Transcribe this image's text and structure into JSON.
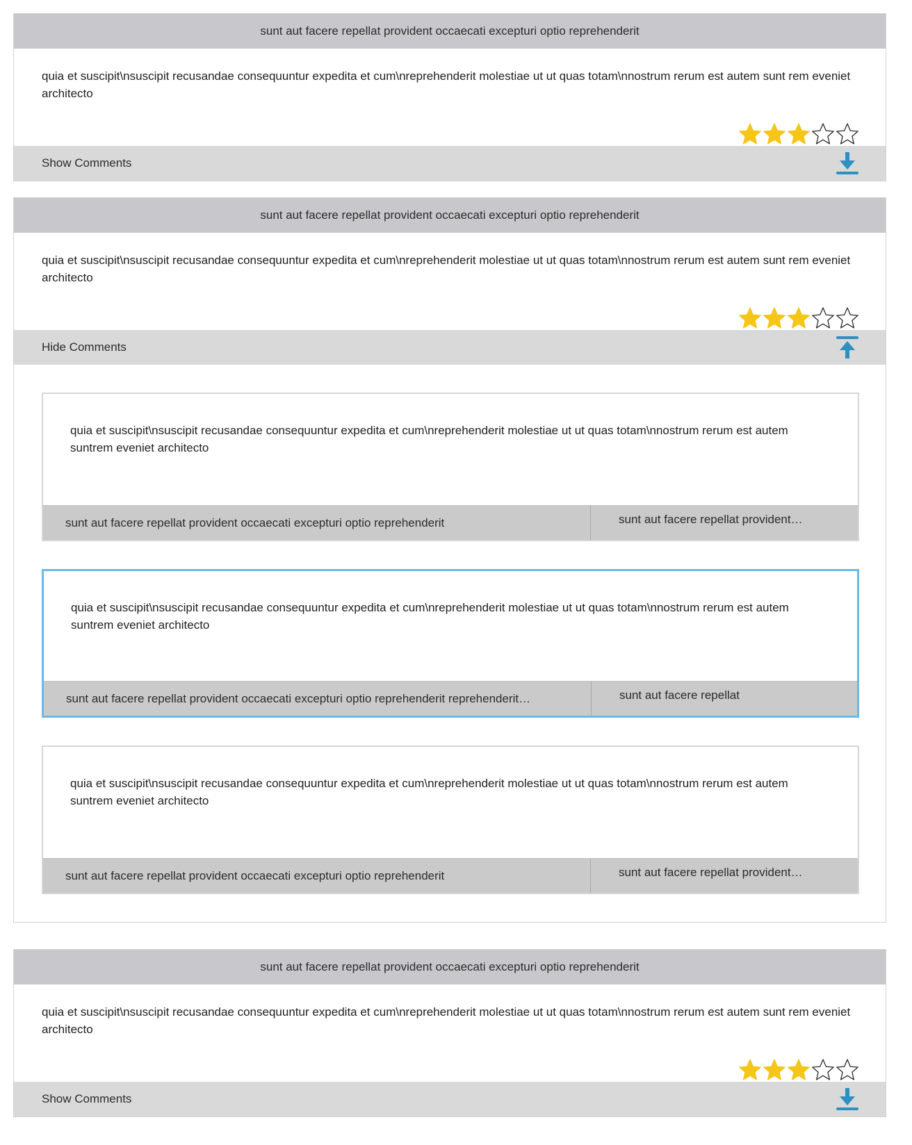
{
  "colors": {
    "header_bg": "#c8c8cc",
    "bar_bg": "#d9d9d9",
    "star_filled": "#f5c518",
    "icon_blue": "#2e8fc0",
    "selected_border": "#6ab9ea"
  },
  "posts": [
    {
      "title": "sunt aut facere repellat provident occaecati excepturi optio reprehenderit",
      "body": "quia et suscipit\\nsuscipit recusandae consequuntur expedita et cum\\nreprehenderit molestiae ut ut quas totam\\nnostrum rerum est autem sunt rem eveniet architecto",
      "rating": 3,
      "rating_max": 5,
      "toggle_label": "Show Comments",
      "toggle_icon": "download-arrow-icon"
    },
    {
      "title": "sunt aut facere repellat provident occaecati excepturi optio reprehenderit",
      "body": "quia et suscipit\\nsuscipit recusandae consequuntur expedita et cum\\nreprehenderit molestiae ut ut quas totam\\nnostrum rerum est autem sunt rem eveniet architecto",
      "rating": 3,
      "rating_max": 5,
      "toggle_label": "Hide Comments",
      "toggle_icon": "upload-arrow-icon",
      "comments": [
        {
          "body": "quia et suscipit\\nsuscipit recusandae consequuntur expedita et cum\\nreprehenderit molestiae ut ut quas totam\\nnostrum rerum est autem suntrem eveniet architecto",
          "name": "sunt aut facere repellat provident occaecati excepturi optio reprehenderit",
          "email": "sunt aut facere repellat provident…"
        },
        {
          "body": "quia et suscipit\\nsuscipit recusandae consequuntur expedita et cum\\nreprehenderit molestiae ut ut quas totam\\nnostrum rerum est autem suntrem eveniet architecto",
          "name": "sunt aut facere repellat provident occaecati excepturi optio reprehenderit reprehenderit…",
          "email": "sunt aut facere repellat",
          "selected": true
        },
        {
          "body": "quia et suscipit\\nsuscipit recusandae consequuntur expedita et cum\\nreprehenderit molestiae ut ut quas totam\\nnostrum rerum est autem suntrem eveniet architecto",
          "name": "sunt aut facere repellat provident occaecati excepturi optio reprehenderit",
          "email": "sunt aut facere repellat provident…"
        }
      ]
    },
    {
      "title": "sunt aut facere repellat provident occaecati excepturi optio reprehenderit",
      "body": "quia et suscipit\\nsuscipit recusandae consequuntur expedita et cum\\nreprehenderit molestiae ut ut quas totam\\nnostrum rerum est autem sunt rem eveniet architecto",
      "rating": 3,
      "rating_max": 5,
      "toggle_label": "Show Comments",
      "toggle_icon": "download-arrow-icon"
    }
  ]
}
